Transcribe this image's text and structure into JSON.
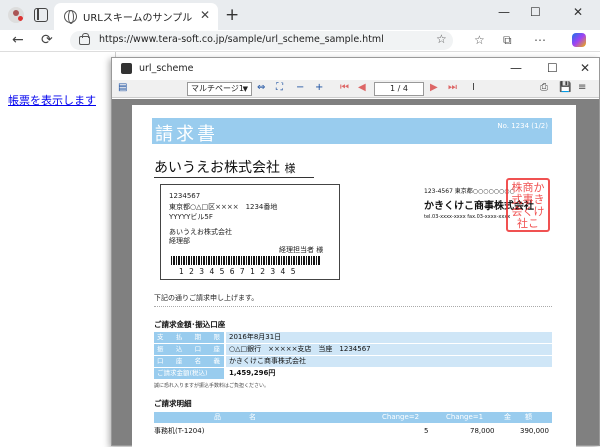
{
  "browser": {
    "tab_title": "URLスキームのサンプル",
    "tab_close": "✕",
    "new_tab": "+",
    "minimize": "—",
    "maximize": "☐",
    "close": "✕",
    "back": "←",
    "refresh": "⟳",
    "url": "https://www.tera-soft.co.jp/sample/url_scheme_sample.html",
    "more": "⋯"
  },
  "page": {
    "link_text": "帳票を表示します"
  },
  "pdf_viewer": {
    "window_title": "url_scheme",
    "minimize": "—",
    "maximize": "☐",
    "close": "✕",
    "zoom_value": "マルチページ1",
    "page_indicator": "1 / 4",
    "zoom_out": "−",
    "zoom_in": "+"
  },
  "invoice": {
    "title": "請求書",
    "number": "No. 1234 (1/2)",
    "customer": "あいうえお株式会社",
    "customer_suffix": "様",
    "postal": "1234567",
    "address1": "東京都○△□区××××　1234番地",
    "address2": "YYYYYビル5F",
    "company": "あいうえお株式会社",
    "dept": "経理部",
    "contact": "経理担当者",
    "contact_suffix": "様",
    "barcode_digits": "1 2 3 4 5 6 7 1 2 3 4 5",
    "issuer_address": "123-4567 東京都○○○○○○○○",
    "issuer_name": "かきくけこ商事株式会社",
    "issuer_tel": "tel.03-xxxx-xxxx fax.03-xxxx-xxxx",
    "seal_text": "株 商 か 式 事 き 会 く 社 け こ",
    "intro": "下記の通りご請求申し上げます。",
    "section_payment": "ご請求金額･振込口座",
    "due_label": "支払期限",
    "due_value": "2016年8月31日",
    "bank_label": "振込口座",
    "bank_value": "○△□銀行　×××××支店　当座　1234567",
    "holder_label": "口座名義",
    "holder_value": "かきくけこ商事株式会社",
    "amount_label": "ご請求金額(税込)",
    "amount_value": "1,459,296円",
    "fine_print": "誠に恐れ入りますが振込手数料はご負担ください。",
    "section_details": "ご請求明細",
    "col_item": "品　　　　名",
    "col_qty": "Change=2",
    "col_price": "Change=1",
    "col_amount": "金　　額",
    "row1_item": "事務机(T-1204)",
    "row1_qty": "5",
    "row1_price": "78,000",
    "row1_amount": "390,000"
  }
}
